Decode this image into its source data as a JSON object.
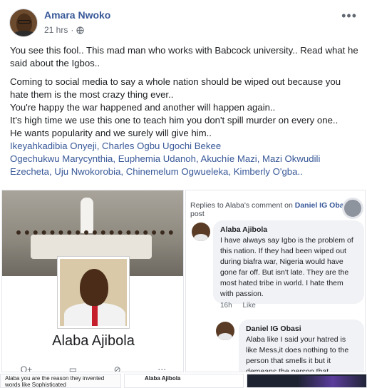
{
  "post": {
    "author": "Amara Nwoko",
    "time": "21 hrs",
    "privacy_icon": "globe-icon",
    "more_icon": "ellipsis-icon",
    "more_label": "•••",
    "paragraphs": [
      "You see this fool.. This mad man who works with Babcock university.. Read what he said about the Igbos..",
      "Coming to social media to say a whole nation should be wiped out because you hate them is the most crazy thing ever..",
      "You're happy the war happened and another will happen again..",
      "It's high time we use this one to teach him you don't spill murder on every one..",
      "He wants popularity and we surely will give him.."
    ],
    "tags_line1": "Ikeyahkadibia Onyeji, Charles Ogbu Ugochi Bekee",
    "tags_line2": "Ogechukwu Marycynthia, Euphemia Udanoh, Akuchíe Mazi, Mazi Okwudili",
    "tags_line3": "Ezecheta, Uju Nwokorobia, Chinemelum Ogwueleka, Kimberly O'gba.."
  },
  "gallery": {
    "left": {
      "profile_name": "Alaba Ajibola",
      "actions": [
        "O+",
        "▭",
        "⊘",
        "⋯"
      ]
    },
    "right": {
      "replies_prefix": "Replies to Alaba's comment on ",
      "replies_owner": "Daniel IG Obasi",
      "replies_suffix": "'s post",
      "comments": [
        {
          "name": "Alaba Ajibola",
          "text": "I have always say Igbo is the problem of this nation. If they had been wiped out during biafra war, Nigeria would have gone far off. But isn't late. They are the most hated tribe in world. I hate them with passion.",
          "time": "16h",
          "like": "Like"
        },
        {
          "name": "Daniel IG Obasi",
          "text": "Alaba like I said your hatred is like Mess,it does nothing to the person that smells it but it demeans the person that"
        }
      ]
    },
    "strips": {
      "first": "Alaba you are the reason they invented words like Sophisticated",
      "second": "Alaba Ajibola"
    }
  },
  "colors": {
    "link": "#385898",
    "text": "#1c1e21",
    "meta": "#616770",
    "bubble": "#f0f2f5"
  }
}
